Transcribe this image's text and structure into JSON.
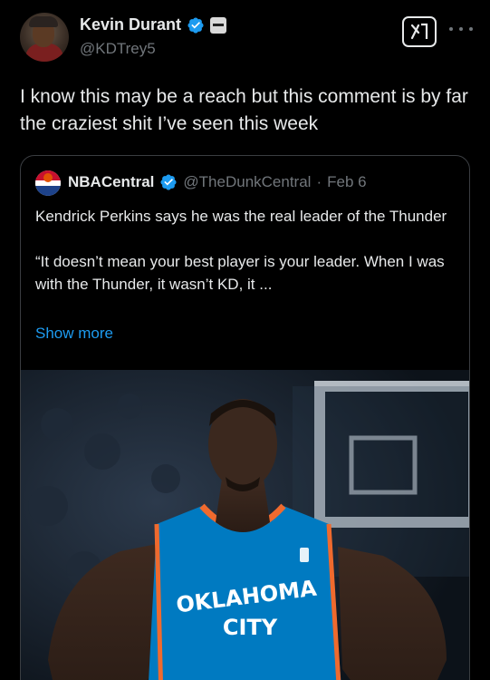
{
  "author": {
    "display_name": "Kevin Durant",
    "handle": "@KDTrey5"
  },
  "tweet": {
    "text": "I know this may be a reach but this comment is by far the craziest shit I’ve seen this week"
  },
  "quoted": {
    "name": "NBACentral",
    "handle": "@TheDunkCentral",
    "separator": "·",
    "date": "Feb 6",
    "paragraph_1": "Kendrick Perkins says he was the real leader of the Thunder",
    "paragraph_2": "“It doesn’t mean your best player is your leader. When I was with the Thunder, it wasn’t KD, it ...",
    "show_more": "Show more"
  },
  "photo": {
    "jersey_line_1": "OKLAHOMA",
    "jersey_line_2": "CITY"
  },
  "colors": {
    "background": "#000000",
    "text": "#e7e9ea",
    "secondary": "#71767b",
    "link": "#1d9bf0",
    "verified": "#1d9bf0",
    "jersey": "#007ac1",
    "jersey_trim": "#ef6a2e"
  },
  "icons": {
    "verified": "verified-badge-icon",
    "grok": "grok-icon",
    "more": "more-dots-icon",
    "affiliate": "affiliate-badge-icon"
  }
}
